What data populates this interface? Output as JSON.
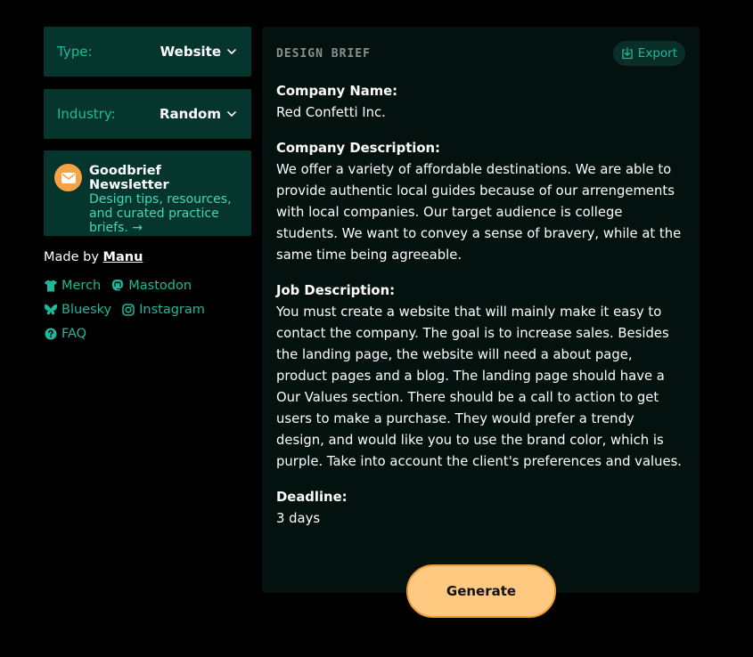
{
  "sidebar": {
    "type_select": {
      "label": "Type:",
      "value": "Website"
    },
    "industry_select": {
      "label": "Industry:",
      "value": "Random"
    },
    "newsletter": {
      "title": "Goodbrief Newsletter",
      "description": "Design tips, resources, and curated practice briefs. →",
      "icon": "mail-icon"
    },
    "made_by": {
      "prefix": "Made by ",
      "author": "Manu"
    },
    "links": {
      "merch": "Merch",
      "mastodon": "Mastodon",
      "bluesky": "Bluesky",
      "instagram": "Instagram",
      "faq": "FAQ"
    }
  },
  "brief": {
    "header": "DESIGN BRIEF",
    "export_label": "Export",
    "company_name_label": "Company Name:",
    "company_name": "Red Confetti Inc.",
    "company_description_label": "Company Description:",
    "company_description": "We offer a variety of affordable destinations. We are able to provide authentic local guides because of our arrengements with local companies. Our target audience is college students. We want to convey a sense of bravery, while at the same time being agreeable.",
    "job_description_label": "Job Description:",
    "job_description": "You must create a website that will mainly make it easy to contact the company. The goal is to increase sales. Besides the landing page, the website will need a about page, product pages and a blog. The landing page should have a Our Values section. There should be a call to action to get users to make a purchase. They would prefer a trendy design, and would like you to use the brand color, which is purple. Take into account the client's preferences and values.",
    "deadline_label": "Deadline:",
    "deadline": "3 days"
  },
  "generate_label": "Generate",
  "colors": {
    "background": "#000000",
    "panel": "#06352e",
    "brief_bg": "#03110f",
    "accent": "#1fb89a",
    "generate": "#ffc982",
    "mail_badge": "#f5a345"
  }
}
